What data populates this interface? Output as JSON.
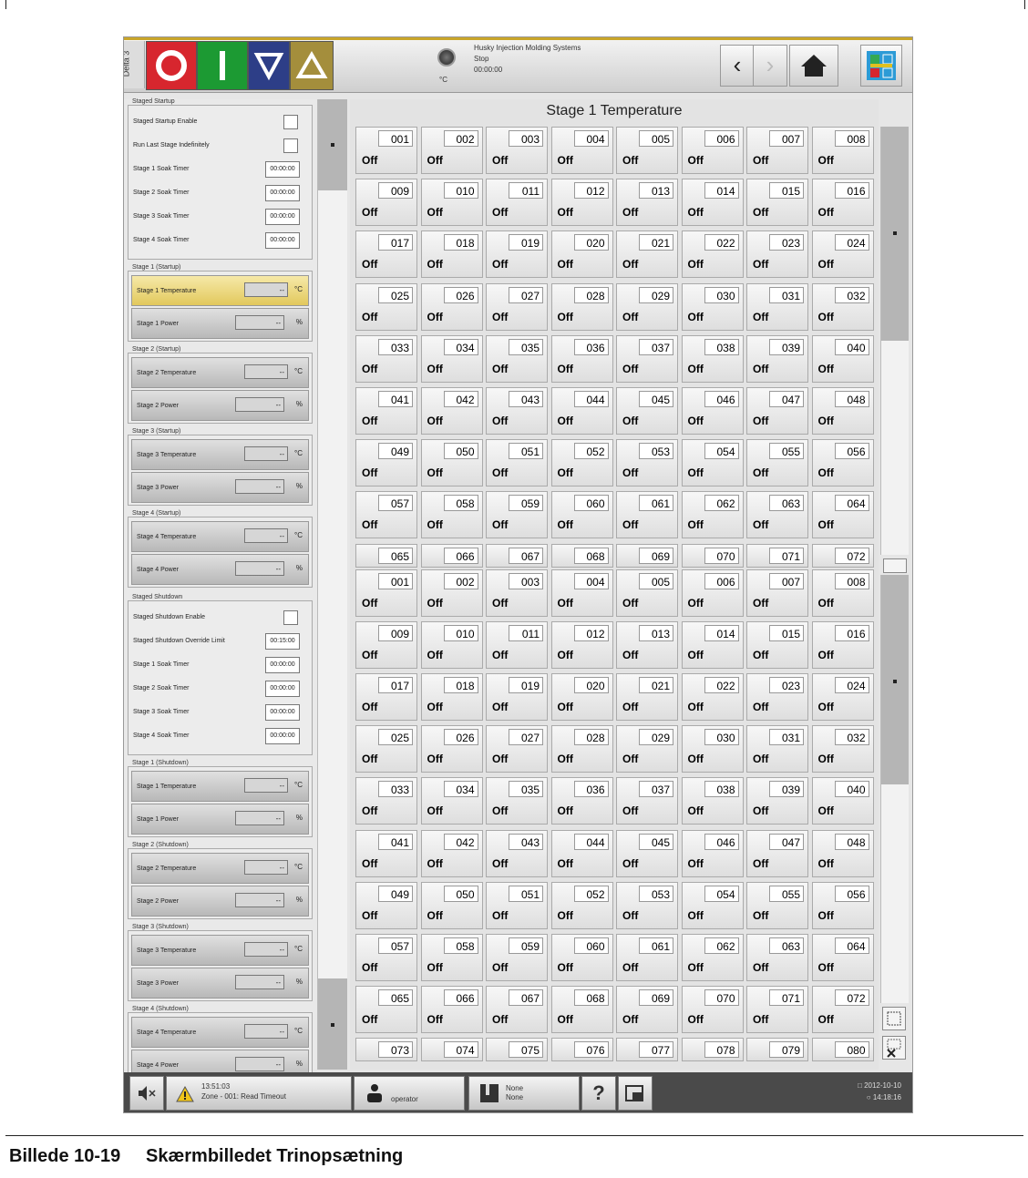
{
  "caption": {
    "number": "Billede 10-19",
    "title": "Skærmbilledet Trinopsætning"
  },
  "topbar": {
    "tab_label": "Delta 3",
    "status_unit": "°C",
    "status_lines": [
      "Husky Injection Molding Systems",
      "Stop",
      "00:00:00"
    ]
  },
  "left": {
    "staged_startup": {
      "title": "Staged Startup",
      "rows": [
        {
          "label": "Staged Startup Enable",
          "kind": "check"
        },
        {
          "label": "Run Last Stage Indefinitely",
          "kind": "check"
        },
        {
          "label": "Stage 1 Soak Timer",
          "kind": "time",
          "value": "00:00:00"
        },
        {
          "label": "Stage 2 Soak Timer",
          "kind": "time",
          "value": "00:00:00"
        },
        {
          "label": "Stage 3 Soak Timer",
          "kind": "time",
          "value": "00:00:00"
        },
        {
          "label": "Stage 4 Soak Timer",
          "kind": "time",
          "value": "00:00:00"
        }
      ]
    },
    "startup_stages": [
      {
        "title": "Stage 1 (Startup)",
        "temp_label": "Stage 1 Temperature",
        "power_label": "Stage 1 Power"
      },
      {
        "title": "Stage 2 (Startup)",
        "temp_label": "Stage 2 Temperature",
        "power_label": "Stage 2 Power"
      },
      {
        "title": "Stage 3 (Startup)",
        "temp_label": "Stage 3 Temperature",
        "power_label": "Stage 3 Power"
      },
      {
        "title": "Stage 4 (Startup)",
        "temp_label": "Stage 4 Temperature",
        "power_label": "Stage 4 Power"
      }
    ],
    "staged_shutdown": {
      "title": "Staged Shutdown",
      "rows": [
        {
          "label": "Staged Shutdown Enable",
          "kind": "check"
        },
        {
          "label": "Staged Shutdown Override Limit",
          "kind": "time",
          "value": "00:15:00"
        },
        {
          "label": "Stage 1 Soak Timer",
          "kind": "time",
          "value": "00:00:00"
        },
        {
          "label": "Stage 2 Soak Timer",
          "kind": "time",
          "value": "00:00:00"
        },
        {
          "label": "Stage 3 Soak Timer",
          "kind": "time",
          "value": "00:00:00"
        },
        {
          "label": "Stage 4 Soak Timer",
          "kind": "time",
          "value": "00:00:00"
        }
      ]
    },
    "shutdown_stages": [
      {
        "title": "Stage 1 (Shutdown)",
        "temp_label": "Stage 1 Temperature",
        "power_label": "Stage 1 Power"
      },
      {
        "title": "Stage 2 (Shutdown)",
        "temp_label": "Stage 2 Temperature",
        "power_label": "Stage 2 Power"
      },
      {
        "title": "Stage 3 (Shutdown)",
        "temp_label": "Stage 3 Temperature",
        "power_label": "Stage 3 Power"
      },
      {
        "title": "Stage 4 (Shutdown)",
        "temp_label": "Stage 4 Temperature",
        "power_label": "Stage 4 Power"
      }
    ],
    "empty_value": "--",
    "temp_unit": "°C",
    "power_unit": "%"
  },
  "main": {
    "title": "Stage 1 Temperature",
    "zone_state": "Off",
    "block1_rows": 8,
    "block1_partial_row": [
      "065",
      "066",
      "067",
      "068",
      "069",
      "070",
      "071",
      "072"
    ],
    "block2_rows": 9,
    "block2_partial_row": [
      "073",
      "074",
      "075",
      "076",
      "077",
      "078",
      "079",
      "080"
    ]
  },
  "bottom": {
    "alarm_time": "13:51:03",
    "alarm_text": "Zone - 001: Read Timeout",
    "user": "operator",
    "mold_line1": "None",
    "mold_line2": "None",
    "help": "?",
    "date": "2012-10-10",
    "time": "14:18:16"
  }
}
